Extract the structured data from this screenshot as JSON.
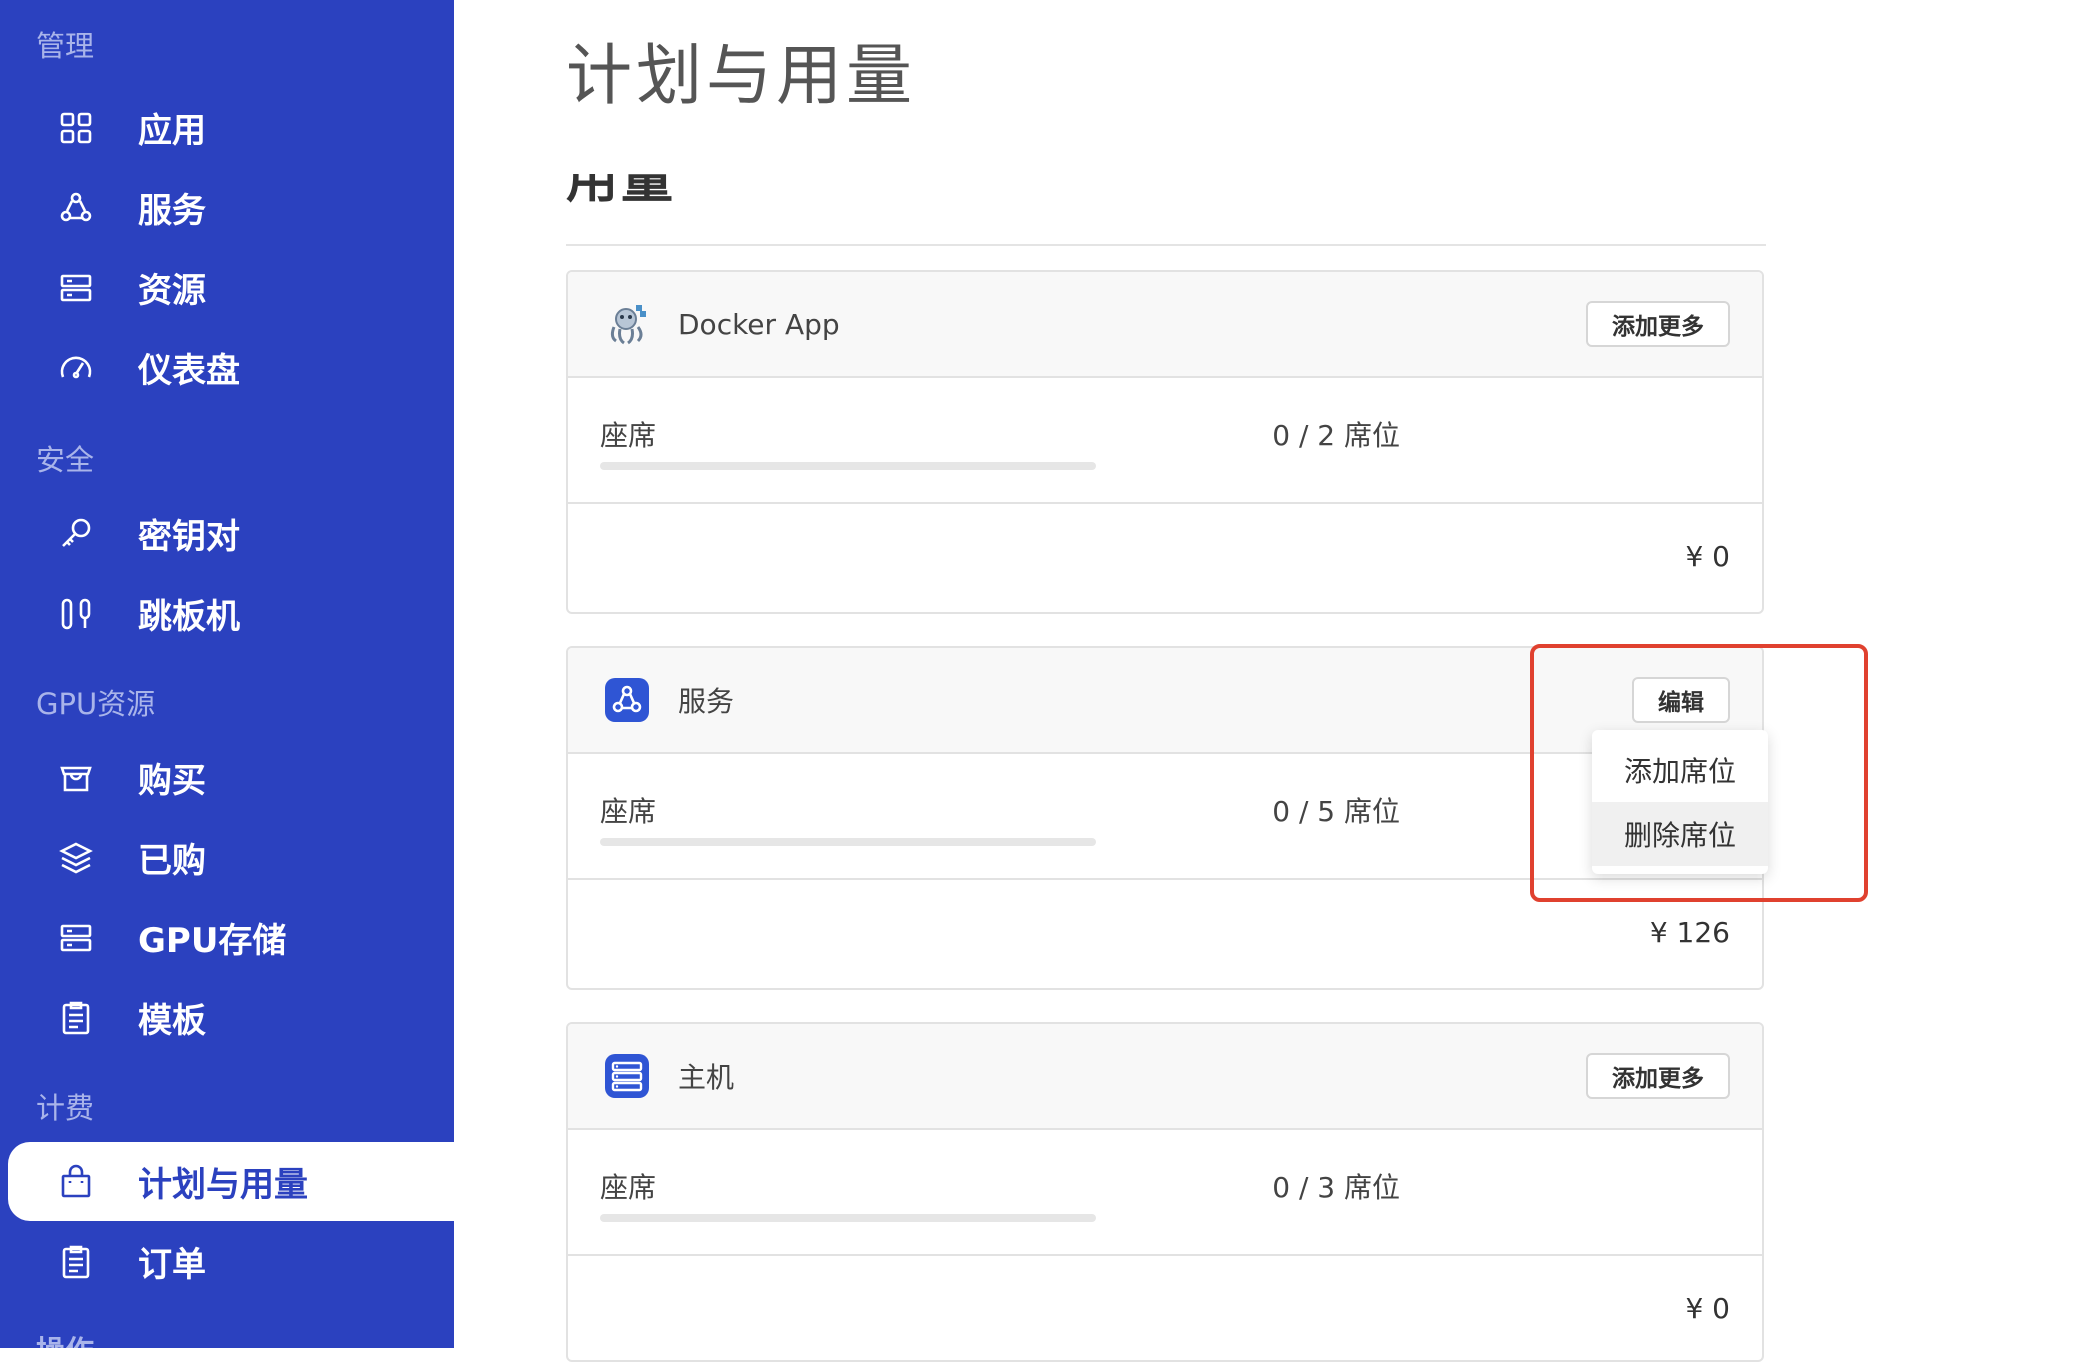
{
  "sidebar": {
    "sections": [
      {
        "title": "管理",
        "items": [
          {
            "label": "应用",
            "icon": "apps-grid-icon"
          },
          {
            "label": "服务",
            "icon": "services-icon"
          },
          {
            "label": "资源",
            "icon": "server-icon"
          },
          {
            "label": "仪表盘",
            "icon": "dashboard-gauge-icon"
          }
        ]
      },
      {
        "title": "安全",
        "items": [
          {
            "label": "密钥对",
            "icon": "key-icon"
          },
          {
            "label": "跳板机",
            "icon": "jump-host-icon"
          }
        ]
      },
      {
        "title": "GPU资源",
        "items": [
          {
            "label": "购买",
            "icon": "shop-icon"
          },
          {
            "label": "已购",
            "icon": "layers-icon"
          },
          {
            "label": "GPU存储",
            "icon": "storage-icon"
          },
          {
            "label": "模板",
            "icon": "template-icon"
          }
        ]
      },
      {
        "title": "计费",
        "items": [
          {
            "label": "计划与用量",
            "icon": "shopping-bag-icon",
            "active": true
          },
          {
            "label": "订单",
            "icon": "orders-icon"
          }
        ]
      }
    ],
    "clipped_section": "操作"
  },
  "main": {
    "page_title": "计划与用量",
    "section_title": "用量",
    "cards": [
      {
        "name": "Docker App",
        "icon": "docker-icon",
        "button": "添加更多",
        "seat_label": "座席",
        "seat_value": "0 / 2 席位",
        "seat_fraction": 0,
        "price": "¥ 0"
      },
      {
        "name": "服务",
        "icon": "services-badge-icon",
        "button": "编辑",
        "seat_label": "座席",
        "seat_value": "0 / 5 席位",
        "seat_fraction": 0,
        "price": "¥ 126"
      },
      {
        "name": "主机",
        "icon": "host-badge-icon",
        "button": "添加更多",
        "seat_label": "座席",
        "seat_value": "0 / 3 席位",
        "seat_fraction": 0,
        "price": "¥ 0"
      }
    ],
    "dropdown": {
      "items": [
        "添加席位",
        "删除席位"
      ],
      "hovered_index": 1
    }
  },
  "colors": {
    "sidebar_bg": "#2b41bf",
    "highlight": "#e0412f"
  }
}
